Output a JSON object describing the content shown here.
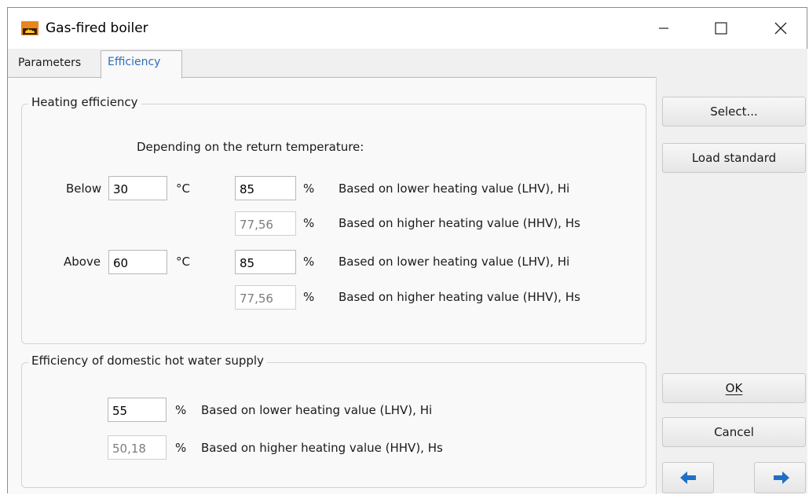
{
  "window": {
    "title": "Gas-fired boiler"
  },
  "tabs": [
    {
      "label": "Parameters",
      "active": false
    },
    {
      "label": "Efficiency",
      "active": true
    }
  ],
  "heating": {
    "group_title": "Heating efficiency",
    "subtitle": "Depending on the return temperature:",
    "below": {
      "label": "Below",
      "temp": "30",
      "temp_unit": "°C",
      "lhv_value": "85",
      "hhv_value": "77,56"
    },
    "above": {
      "label": "Above",
      "temp": "60",
      "temp_unit": "°C",
      "lhv_value": "85",
      "hhv_value": "77,56"
    },
    "percent": "%",
    "lhv_text": "Based on lower heating value (LHV), Hi",
    "hhv_text": "Based on higher heating value (HHV), Hs"
  },
  "dhw": {
    "group_title": "Efficiency of domestic hot water supply",
    "lhv_value": "55",
    "hhv_value": "50,18",
    "percent": "%",
    "lhv_text": "Based on lower heating value (LHV), Hi",
    "hhv_text": "Based on higher heating value (HHV), Hs"
  },
  "buttons": {
    "select": "Select...",
    "load_standard": "Load standard",
    "ok": "OK",
    "cancel": "Cancel"
  },
  "icons": {
    "app": "boiler-app-icon",
    "minimize": "minimize-icon",
    "maximize": "maximize-icon",
    "close": "close-icon",
    "prev": "arrow-left-icon",
    "next": "arrow-right-icon"
  },
  "colors": {
    "active_tab_text": "#2a6fb5",
    "arrow_blue": "#1f6fc4",
    "icon_orange": "#e8861a"
  }
}
